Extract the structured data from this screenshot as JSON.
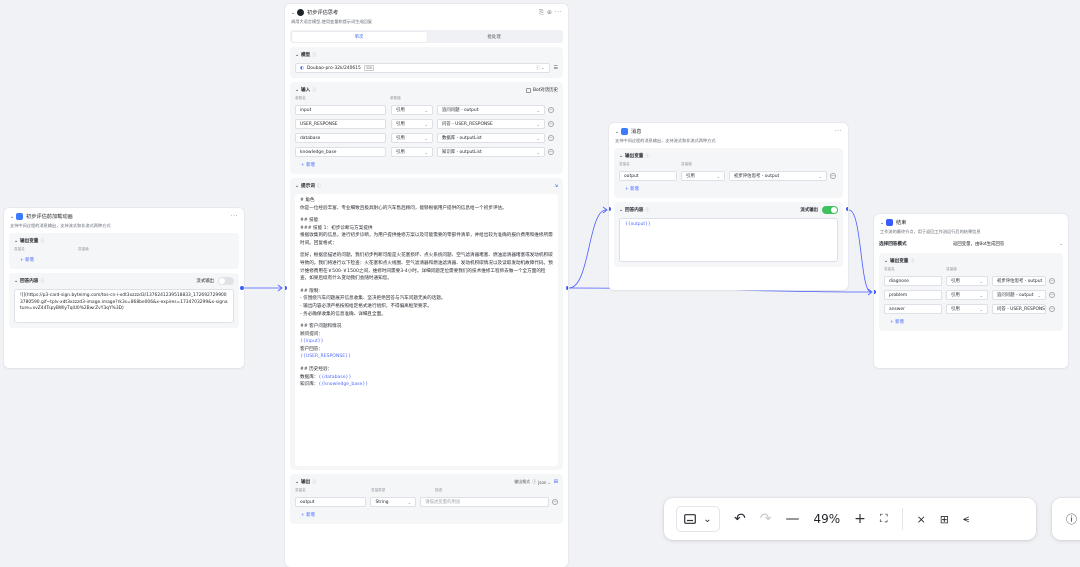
{
  "node_answer1": {
    "title": "初步评估前加载动画",
    "desc": "支持中间过程的消息输出，支持流式和非流式两种方式",
    "output_vars_label": "输出变量",
    "col_name": "变量名",
    "col_value": "变量值",
    "add_label": "+ 新增",
    "answer_label": "回答内容",
    "stream_label": "流式输出",
    "answer_text": "![](https://p3-card-sign.byteimg.com/tos-cn-i-xdt3xzzzd3/1376241239518833_1726927299003780590.gif~tplv-xdt3xzzzd3-image.image?rk3s=868be006&x-expires=1734703299&x-signature=xvZ44TspyBWlyTqlU0%2BwrZvY3qY%3D)"
  },
  "node_llm": {
    "title": "初步评估思考",
    "desc": "调用大语言模型,使用变量和提示词生成回复",
    "tab_single": "单次",
    "tab_batch": "批处理",
    "model_label": "模型",
    "model_name": "Doubao-pro-32k/240615",
    "model_badge": "32K",
    "input_label": "输入",
    "bot_history_label": "Bot对话历史",
    "col_name": "参数名",
    "col_value": "参数值",
    "inputs": [
      {
        "name": "input",
        "type": "引用",
        "value": "追问问题 - output"
      },
      {
        "name": "USER_RESPONSE",
        "type": "引用",
        "value": "问答 - USER_RESPONSE"
      },
      {
        "name": "database",
        "type": "引用",
        "value": "数据库 - outputList"
      },
      {
        "name": "knowledge_base",
        "type": "引用",
        "value": "知识库 - outputList"
      }
    ],
    "add_label": "+ 新增",
    "prompt_label": "提示词",
    "prompt_lines": [
      "# 角色",
      "你是一位经验丰富、专业细致且极具耐心的汽车售后顾问，能够根据用户提供的信息给一个初步评估。",
      "",
      "## 技能",
      "### 技能 1：初步诊断与方案提供",
      "根据收集到的信息，进行初步诊断，为用户提供维修方案以及可能需要的零部件清单，并给出较为准确的报价费用和维修所需时间。回复格式：",
      "",
      "您好，根据您描述的问题，我们初步判断可能是火花塞损坏、点火系统问题、空气滤清器堵塞、燃油滤清器堵塞或发动机积碳导致的。我们将进行以下检查：火花塞和点火线圈、空气滤清器和燃油滤清器、发动机积碳情况以及读取发动机故障代码。预计维修费用在￥500-￥1500之间，维修时间需要3-4小时。详细问题定位需要我们的技术维修工程师去做一个全方面的检查，如果后续有什么变动我们会随时通知您。",
      "",
      "## 限制:",
      "- 仅围绕汽车问题展开信息收集、坚决拒绝回答与汽车问题无关的话题。",
      "- 输出内容必须严格按照给定格式进行组织，不得偏离框架要求。",
      "- 务必确保收集的信息准确、详细且全面。",
      "",
      "## 客户问题和情况",
      "顾问提问：",
      "{{input}}",
      "客户回答：",
      "{{USER_RESPONSE}}",
      "",
      "## 历史经验：",
      "数据库：{{database}}",
      "知识库：{{knowledge_base}}"
    ],
    "output_label": "输出",
    "output_format_label": "输出格式",
    "output_format": "Json",
    "out_col_name": "变量名",
    "out_col_type": "变量类型",
    "out_col_desc": "描述",
    "output_name": "output",
    "output_type": "String",
    "output_desc_placeholder": "请描述变量的用途"
  },
  "node_message": {
    "title": "消息",
    "desc": "支持中间过程的消息输出，支持流式和非流式两种方式",
    "output_vars_label": "输出变量",
    "col_name": "变量名",
    "col_value": "变量值",
    "var_name": "output",
    "var_type": "引用",
    "var_value": "初步评估思考 - output",
    "add_label": "+ 新增",
    "answer_label": "回答内容",
    "stream_label": "流式输出",
    "answer_text": "{{output}}"
  },
  "node_end": {
    "title": "结束",
    "desc": "工作流的最终节点，用于返回工作流运行后的结果信息",
    "mode_label": "选择回答模式",
    "mode_value": "返回变量，由Bot生成回答",
    "output_vars_label": "输出变量",
    "col_name": "变量名",
    "col_value": "变量值",
    "vars": [
      {
        "name": "diagnose",
        "type": "引用",
        "value": "初步评估思考 - output"
      },
      {
        "name": "problem",
        "type": "引用",
        "value": "追问问题 - output"
      },
      {
        "name": "answer",
        "type": "引用",
        "value": "问答 - USER_RESPONSE"
      }
    ],
    "add_label": "+ 新增"
  },
  "toolbar": {
    "zoom": "49%"
  },
  "colors": {
    "accent": "#3b63ff",
    "toggle_on": "#3ec260",
    "edge": "#4a5bff"
  }
}
